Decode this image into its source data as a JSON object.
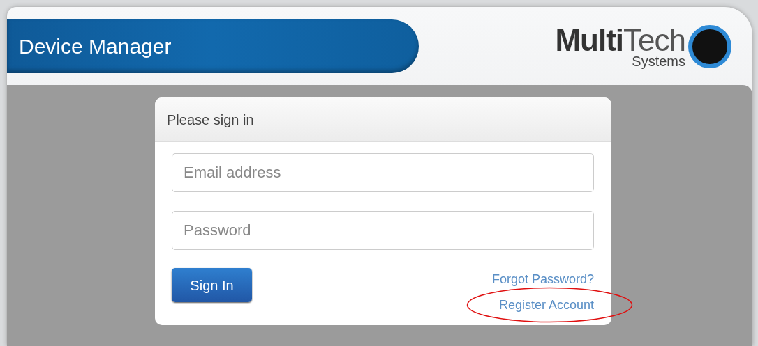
{
  "header": {
    "title": "Device Manager",
    "logo": {
      "bold": "Multi",
      "light": "Tech",
      "sub": "Systems"
    }
  },
  "signin": {
    "heading": "Please sign in",
    "fields": [
      {
        "placeholder": "Email address"
      },
      {
        "placeholder": "Password"
      }
    ],
    "button": "Sign In",
    "links": [
      {
        "label": "Forgot Password?"
      },
      {
        "label": "Register Account"
      }
    ],
    "annotation": {
      "kind": "ellipse"
    }
  }
}
